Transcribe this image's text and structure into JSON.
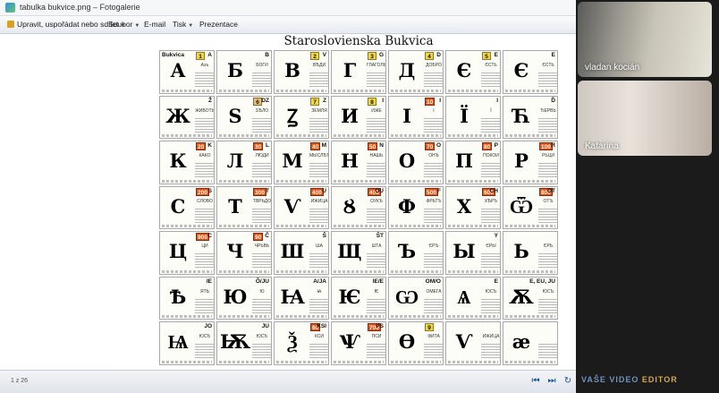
{
  "window": {
    "title": "tabulka bukvice.png – Fotogalerie"
  },
  "menu": {
    "organize": "Upravit, uspořádat nebo sdílet",
    "file": "Soubor",
    "email": "E-mail",
    "print": "Tisk",
    "slideshow": "Prezentace"
  },
  "document": {
    "title": "Staroslovienska Bukvica",
    "header_cell": "Bukvica",
    "letters": [
      {
        "glyph": "А",
        "num": "1",
        "numStyle": "yellow",
        "lat": "A",
        "name": "Азъ"
      },
      {
        "glyph": "Б",
        "num": "",
        "numStyle": "",
        "lat": "B",
        "name": "БОГИ"
      },
      {
        "glyph": "В",
        "num": "2",
        "numStyle": "yellow",
        "lat": "V",
        "name": "ВѢДИ"
      },
      {
        "glyph": "Г",
        "num": "3",
        "numStyle": "yellow",
        "lat": "G",
        "name": "ГЛАГОЛЬ"
      },
      {
        "glyph": "Д",
        "num": "4",
        "numStyle": "yellow",
        "lat": "D",
        "name": "ДОБРО"
      },
      {
        "glyph": "Є",
        "num": "5",
        "numStyle": "yellow",
        "lat": "E",
        "name": "ЄСТЬ"
      },
      {
        "glyph": "Є",
        "num": "",
        "numStyle": "",
        "lat": "E",
        "name": "ЄСТЬ"
      },
      {
        "glyph": "Ж",
        "num": "",
        "numStyle": "",
        "lat": "Ž",
        "name": "ЖИВОТЬ"
      },
      {
        "glyph": "Ѕ",
        "num": "6",
        "numStyle": "tan",
        "lat": "DZ",
        "name": "ЅѢЛО"
      },
      {
        "glyph": "Ꙁ",
        "num": "7",
        "numStyle": "yellow",
        "lat": "Z",
        "name": "ЗЕМЛЯ"
      },
      {
        "glyph": "И",
        "num": "8",
        "numStyle": "yellow",
        "lat": "I",
        "name": "ИЖЕ"
      },
      {
        "glyph": "І",
        "num": "10",
        "numStyle": "red",
        "lat": "I",
        "name": "І"
      },
      {
        "glyph": "Ї",
        "num": "",
        "numStyle": "",
        "lat": "I",
        "name": "Ї"
      },
      {
        "glyph": "Ћ",
        "num": "",
        "numStyle": "",
        "lat": "Ď",
        "name": "ЂЕРВЬ"
      },
      {
        "glyph": "К",
        "num": "20",
        "numStyle": "red",
        "lat": "K",
        "name": "КАКО"
      },
      {
        "glyph": "Л",
        "num": "30",
        "numStyle": "red",
        "lat": "L",
        "name": "ЛЮДИ"
      },
      {
        "glyph": "М",
        "num": "40",
        "numStyle": "red",
        "lat": "M",
        "name": "МЫСЛѢТЕ"
      },
      {
        "glyph": "Н",
        "num": "50",
        "numStyle": "red",
        "lat": "N",
        "name": "НАШЬ"
      },
      {
        "glyph": "О",
        "num": "70",
        "numStyle": "red",
        "lat": "O",
        "name": "ОНЪ"
      },
      {
        "glyph": "П",
        "num": "80",
        "numStyle": "red",
        "lat": "P",
        "name": "ПОКОИ"
      },
      {
        "glyph": "Р",
        "num": "100",
        "numStyle": "red",
        "lat": "R",
        "name": "РЬЦИ"
      },
      {
        "glyph": "С",
        "num": "200",
        "numStyle": "red",
        "lat": "S",
        "name": "СЛОВО"
      },
      {
        "glyph": "Т",
        "num": "300",
        "numStyle": "red",
        "lat": "T",
        "name": "ТВРЬДО"
      },
      {
        "glyph": "Ѵ",
        "num": "400",
        "numStyle": "red",
        "lat": "U",
        "name": "ИЖИЦА"
      },
      {
        "glyph": "Ȣ",
        "num": "400",
        "numStyle": "red",
        "lat": "OU",
        "name": "ОУКЪ"
      },
      {
        "glyph": "Ф",
        "num": "500",
        "numStyle": "red",
        "lat": "F",
        "name": "ФРЬТЪ"
      },
      {
        "glyph": "Х",
        "num": "600",
        "numStyle": "red",
        "lat": "CH",
        "name": "ХѢРЪ"
      },
      {
        "glyph": "Ѿ",
        "num": "800",
        "numStyle": "red",
        "lat": "OT",
        "name": "ОТЪ"
      },
      {
        "glyph": "Ц",
        "num": "900",
        "numStyle": "red",
        "lat": "C",
        "name": "ЦИ"
      },
      {
        "glyph": "Ч",
        "num": "90",
        "numStyle": "red",
        "lat": "Č",
        "name": "ЧРЬВЬ"
      },
      {
        "glyph": "Ш",
        "num": "",
        "numStyle": "",
        "lat": "Š",
        "name": "ША"
      },
      {
        "glyph": "Щ",
        "num": "",
        "numStyle": "",
        "lat": "ŠT",
        "name": "ШТА"
      },
      {
        "glyph": "Ъ",
        "num": "",
        "numStyle": "",
        "lat": "",
        "name": "ЄРЪ"
      },
      {
        "glyph": "Ы",
        "num": "",
        "numStyle": "",
        "lat": "Y",
        "name": "ЄРЫ"
      },
      {
        "glyph": "Ь",
        "num": "",
        "numStyle": "",
        "lat": "",
        "name": "ЄРЬ"
      },
      {
        "glyph": "Ѣ",
        "num": "",
        "numStyle": "",
        "lat": "IE",
        "name": "ЯТЬ"
      },
      {
        "glyph": "Ю",
        "num": "",
        "numStyle": "",
        "lat": "Ô/JU",
        "name": "Ю"
      },
      {
        "glyph": "Ꙗ",
        "num": "",
        "numStyle": "",
        "lat": "A/JA",
        "name": "Ꙗ"
      },
      {
        "glyph": "Ѥ",
        "num": "",
        "numStyle": "",
        "lat": "IE/E",
        "name": "Ѥ"
      },
      {
        "glyph": "Ѡ",
        "num": "",
        "numStyle": "",
        "lat": "OM/O",
        "name": "ОМЕГА"
      },
      {
        "glyph": "Ѧ",
        "num": "",
        "numStyle": "",
        "lat": "E",
        "name": "ЮСЪ"
      },
      {
        "glyph": "Ѫ",
        "num": "",
        "numStyle": "",
        "lat": "E, EU, JU",
        "name": "ЮСЪ"
      },
      {
        "glyph": "Ѩ",
        "num": "",
        "numStyle": "",
        "lat": "JO",
        "name": "ЮСЪ"
      },
      {
        "glyph": "Ѭ",
        "num": "",
        "numStyle": "",
        "lat": "JU",
        "name": "ЮСЪ"
      },
      {
        "glyph": "Ѯ",
        "num": "60",
        "numStyle": "red",
        "lat": "KSI",
        "name": "КСИ"
      },
      {
        "glyph": "Ѱ",
        "num": "700",
        "numStyle": "red",
        "lat": "PS",
        "name": "ПСИ"
      },
      {
        "glyph": "Ѳ",
        "num": "9",
        "numStyle": "yellow",
        "lat": "",
        "name": "ФИТА"
      },
      {
        "glyph": "Ѵ",
        "num": "",
        "numStyle": "",
        "lat": "",
        "name": "ИЖИЦА"
      },
      {
        "glyph": "æ",
        "num": "",
        "numStyle": "",
        "lat": "",
        "name": ""
      }
    ]
  },
  "status": {
    "page_counter": "1 z 26"
  },
  "watermark": {
    "text": "VAŠE VIDEO",
    "tail": "EDITOR"
  },
  "participants": [
    {
      "name": "vladan kocián"
    },
    {
      "name": "Katarína"
    }
  ]
}
